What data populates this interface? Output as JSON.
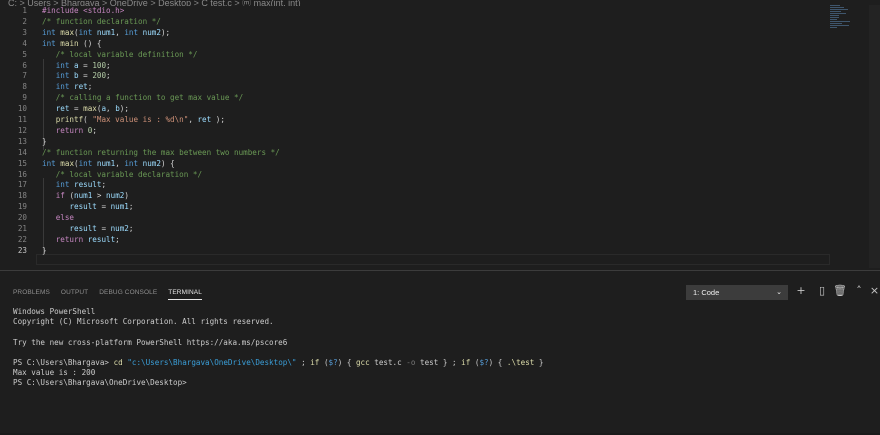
{
  "breadcrumb": "C: > Users > Bhargava > OneDrive > Desktop > C test.c > ⓜ max(int, int)",
  "editor": {
    "lines": [
      {
        "num": "1",
        "tokens": [
          {
            "c": "pp",
            "t": "#include <stdio.h>"
          }
        ]
      },
      {
        "num": "2",
        "tokens": [
          {
            "c": "cm",
            "t": "/* function declaration */"
          }
        ]
      },
      {
        "num": "3",
        "tokens": [
          {
            "c": "kw",
            "t": "int"
          },
          {
            "c": "pn",
            "t": " "
          },
          {
            "c": "fn",
            "t": "max"
          },
          {
            "c": "pn",
            "t": "("
          },
          {
            "c": "kw",
            "t": "int"
          },
          {
            "c": "pn",
            "t": " "
          },
          {
            "c": "id",
            "t": "num1"
          },
          {
            "c": "pn",
            "t": ", "
          },
          {
            "c": "kw",
            "t": "int"
          },
          {
            "c": "pn",
            "t": " "
          },
          {
            "c": "id",
            "t": "num2"
          },
          {
            "c": "pn",
            "t": ");"
          }
        ]
      },
      {
        "num": "4",
        "tokens": [
          {
            "c": "kw",
            "t": "int"
          },
          {
            "c": "pn",
            "t": " "
          },
          {
            "c": "fn",
            "t": "main"
          },
          {
            "c": "pn",
            "t": " () {"
          }
        ]
      },
      {
        "num": "5",
        "tokens": [
          {
            "c": "cm",
            "t": "   /* local variable definition */"
          }
        ]
      },
      {
        "num": "6",
        "tokens": [
          {
            "c": "pn",
            "t": "   "
          },
          {
            "c": "kw",
            "t": "int"
          },
          {
            "c": "pn",
            "t": " "
          },
          {
            "c": "id",
            "t": "a"
          },
          {
            "c": "pn",
            "t": " = "
          },
          {
            "c": "nm",
            "t": "100"
          },
          {
            "c": "pn",
            "t": ";"
          }
        ]
      },
      {
        "num": "7",
        "tokens": [
          {
            "c": "pn",
            "t": "   "
          },
          {
            "c": "kw",
            "t": "int"
          },
          {
            "c": "pn",
            "t": " "
          },
          {
            "c": "id",
            "t": "b"
          },
          {
            "c": "pn",
            "t": " = "
          },
          {
            "c": "nm",
            "t": "200"
          },
          {
            "c": "pn",
            "t": ";"
          }
        ]
      },
      {
        "num": "8",
        "tokens": [
          {
            "c": "pn",
            "t": "   "
          },
          {
            "c": "kw",
            "t": "int"
          },
          {
            "c": "pn",
            "t": " "
          },
          {
            "c": "id",
            "t": "ret"
          },
          {
            "c": "pn",
            "t": ";"
          }
        ]
      },
      {
        "num": "9",
        "tokens": [
          {
            "c": "cm",
            "t": "   /* calling a function to get max value */"
          }
        ]
      },
      {
        "num": "10",
        "tokens": [
          {
            "c": "pn",
            "t": "   "
          },
          {
            "c": "id",
            "t": "ret"
          },
          {
            "c": "pn",
            "t": " = "
          },
          {
            "c": "fn",
            "t": "max"
          },
          {
            "c": "pn",
            "t": "("
          },
          {
            "c": "id",
            "t": "a"
          },
          {
            "c": "pn",
            "t": ", "
          },
          {
            "c": "id",
            "t": "b"
          },
          {
            "c": "pn",
            "t": ");"
          }
        ]
      },
      {
        "num": "11",
        "tokens": [
          {
            "c": "pn",
            "t": "   "
          },
          {
            "c": "fn",
            "t": "printf"
          },
          {
            "c": "pn",
            "t": "( "
          },
          {
            "c": "st",
            "t": "\"Max value is : %d\\n\""
          },
          {
            "c": "pn",
            "t": ", "
          },
          {
            "c": "id",
            "t": "ret"
          },
          {
            "c": "pn",
            "t": " );"
          }
        ]
      },
      {
        "num": "12",
        "tokens": [
          {
            "c": "pn",
            "t": "   "
          },
          {
            "c": "pp",
            "t": "return"
          },
          {
            "c": "pn",
            "t": " "
          },
          {
            "c": "nm",
            "t": "0"
          },
          {
            "c": "pn",
            "t": ";"
          }
        ]
      },
      {
        "num": "13",
        "tokens": [
          {
            "c": "pn",
            "t": "}"
          }
        ]
      },
      {
        "num": "14",
        "tokens": [
          {
            "c": "cm",
            "t": "/* function returning the max between two numbers */"
          }
        ]
      },
      {
        "num": "15",
        "tokens": [
          {
            "c": "kw",
            "t": "int"
          },
          {
            "c": "pn",
            "t": " "
          },
          {
            "c": "fn",
            "t": "max"
          },
          {
            "c": "pn",
            "t": "("
          },
          {
            "c": "kw",
            "t": "int"
          },
          {
            "c": "pn",
            "t": " "
          },
          {
            "c": "id",
            "t": "num1"
          },
          {
            "c": "pn",
            "t": ", "
          },
          {
            "c": "kw",
            "t": "int"
          },
          {
            "c": "pn",
            "t": " "
          },
          {
            "c": "id",
            "t": "num2"
          },
          {
            "c": "pn",
            "t": ") {"
          }
        ]
      },
      {
        "num": "16",
        "tokens": [
          {
            "c": "cm",
            "t": "   /* local variable declaration */"
          }
        ]
      },
      {
        "num": "17",
        "tokens": [
          {
            "c": "pn",
            "t": "   "
          },
          {
            "c": "kw",
            "t": "int"
          },
          {
            "c": "pn",
            "t": " "
          },
          {
            "c": "id",
            "t": "result"
          },
          {
            "c": "pn",
            "t": ";"
          }
        ]
      },
      {
        "num": "18",
        "tokens": [
          {
            "c": "pn",
            "t": "   "
          },
          {
            "c": "pp",
            "t": "if"
          },
          {
            "c": "pn",
            "t": " ("
          },
          {
            "c": "id",
            "t": "num1"
          },
          {
            "c": "pn",
            "t": " > "
          },
          {
            "c": "id",
            "t": "num2"
          },
          {
            "c": "pn",
            "t": ")"
          }
        ]
      },
      {
        "num": "19",
        "tokens": [
          {
            "c": "pn",
            "t": "      "
          },
          {
            "c": "id",
            "t": "result"
          },
          {
            "c": "pn",
            "t": " = "
          },
          {
            "c": "id",
            "t": "num1"
          },
          {
            "c": "pn",
            "t": ";"
          }
        ]
      },
      {
        "num": "20",
        "tokens": [
          {
            "c": "pn",
            "t": "   "
          },
          {
            "c": "pp",
            "t": "else"
          }
        ]
      },
      {
        "num": "21",
        "tokens": [
          {
            "c": "pn",
            "t": "      "
          },
          {
            "c": "id",
            "t": "result"
          },
          {
            "c": "pn",
            "t": " = "
          },
          {
            "c": "id",
            "t": "num2"
          },
          {
            "c": "pn",
            "t": ";"
          }
        ]
      },
      {
        "num": "22",
        "tokens": [
          {
            "c": "pn",
            "t": "   "
          },
          {
            "c": "pp",
            "t": "return"
          },
          {
            "c": "pn",
            "t": " "
          },
          {
            "c": "id",
            "t": "result"
          },
          {
            "c": "pn",
            "t": ";"
          }
        ]
      },
      {
        "num": "23",
        "tokens": [
          {
            "c": "pn",
            "t": "}"
          }
        ]
      }
    ]
  },
  "panel": {
    "tabs": [
      "PROBLEMS",
      "OUTPUT",
      "DEBUG CONSOLE",
      "TERMINAL"
    ],
    "active_tab": "TERMINAL",
    "terminal_select": "1: Code",
    "icons": [
      "plus-icon",
      "split-icon",
      "trash-icon",
      "chevron-up-icon",
      "close-icon"
    ]
  },
  "terminal": {
    "lines": [
      [
        {
          "c": "t-plain",
          "t": "Windows PowerShell"
        }
      ],
      [
        {
          "c": "t-plain",
          "t": "Copyright (C) Microsoft Corporation. All rights reserved."
        }
      ],
      [
        {
          "c": "t-plain",
          "t": ""
        }
      ],
      [
        {
          "c": "t-plain",
          "t": "Try the new cross-platform PowerShell https://aka.ms/pscore6"
        }
      ],
      [
        {
          "c": "t-plain",
          "t": ""
        }
      ],
      [
        {
          "c": "t-plain",
          "t": "PS C:\\Users\\Bhargava> "
        },
        {
          "c": "t-cmd",
          "t": "cd"
        },
        {
          "c": "t-plain",
          "t": " "
        },
        {
          "c": "t-str",
          "t": "\"c:\\Users\\Bhargava\\OneDrive\\Desktop\\\""
        },
        {
          "c": "t-plain",
          "t": " ; "
        },
        {
          "c": "t-cmd",
          "t": "if"
        },
        {
          "c": "t-plain",
          "t": " ("
        },
        {
          "c": "t-var",
          "t": "$?"
        },
        {
          "c": "t-plain",
          "t": ") { "
        },
        {
          "c": "t-cmd",
          "t": "gcc"
        },
        {
          "c": "t-plain",
          "t": " test.c "
        },
        {
          "c": "t-prm",
          "t": "-o"
        },
        {
          "c": "t-plain",
          "t": " test } ; "
        },
        {
          "c": "t-cmd",
          "t": "if"
        },
        {
          "c": "t-plain",
          "t": " ("
        },
        {
          "c": "t-var",
          "t": "$?"
        },
        {
          "c": "t-plain",
          "t": ") { "
        },
        {
          "c": "t-cmd",
          "t": ".\\test"
        },
        {
          "c": "t-plain",
          "t": " }"
        }
      ],
      [
        {
          "c": "t-plain",
          "t": "Max value is : 200"
        }
      ],
      [
        {
          "c": "t-plain",
          "t": "PS C:\\Users\\Bhargava\\OneDrive\\Desktop>"
        }
      ]
    ]
  }
}
